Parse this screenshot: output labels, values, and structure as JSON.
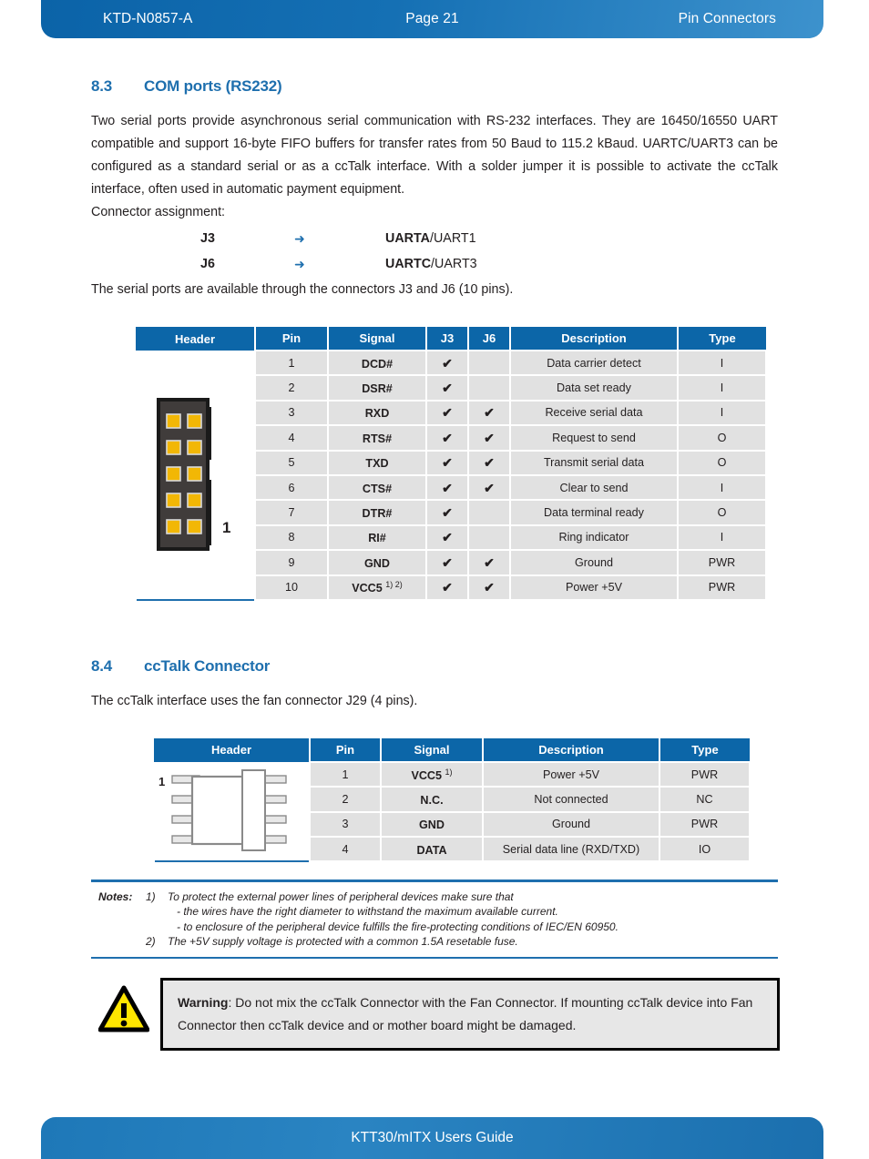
{
  "header": {
    "doc_id": "KTD-N0857-A",
    "page_label": "Page 21",
    "section_label": "Pin Connectors"
  },
  "footer": {
    "title": "KTT30/mITX Users Guide"
  },
  "section_83": {
    "number": "8.3",
    "title": "COM ports (RS232)",
    "paragraph": "Two serial ports provide asynchronous serial communication with RS-232 interfaces. They are 16450/16550 UART compatible and support 16-byte FIFO buffers for transfer rates from 50 Baud to 115.2 kBaud. UARTC/UART3 can be configured as a standard serial or as a ccTalk interface. With a solder jumper it is possible to activate the ccTalk interface, often used in automatic payment equipment.",
    "assignment_intro": "Connector assignment:",
    "assignments": [
      {
        "connector": "J3",
        "arrow": "➜",
        "target_bold": "UARTA",
        "target_rest": "/UART1"
      },
      {
        "connector": "J6",
        "arrow": "➜",
        "target_bold": "UARTC",
        "target_rest": "/UART3"
      }
    ],
    "availability": "The serial ports are available through the connectors J3 and J6 (10 pins).",
    "table": {
      "columns": [
        "Header",
        "Pin",
        "Signal",
        "J3",
        "J6",
        "Description",
        "Type"
      ],
      "connector_pin1_label": "1",
      "rows": [
        {
          "pin": "1",
          "signal": "DCD#",
          "sup": "",
          "j3": "✔",
          "j6": "",
          "desc": "Data carrier detect",
          "type": "I"
        },
        {
          "pin": "2",
          "signal": "DSR#",
          "sup": "",
          "j3": "✔",
          "j6": "",
          "desc": "Data set ready",
          "type": "I"
        },
        {
          "pin": "3",
          "signal": "RXD",
          "sup": "",
          "j3": "✔",
          "j6": "✔",
          "desc": "Receive serial data",
          "type": "I"
        },
        {
          "pin": "4",
          "signal": "RTS#",
          "sup": "",
          "j3": "✔",
          "j6": "✔",
          "desc": "Request to send",
          "type": "O"
        },
        {
          "pin": "5",
          "signal": "TXD",
          "sup": "",
          "j3": "✔",
          "j6": "✔",
          "desc": "Transmit serial data",
          "type": "O"
        },
        {
          "pin": "6",
          "signal": "CTS#",
          "sup": "",
          "j3": "✔",
          "j6": "✔",
          "desc": "Clear to send",
          "type": "I"
        },
        {
          "pin": "7",
          "signal": "DTR#",
          "sup": "",
          "j3": "✔",
          "j6": "",
          "desc": "Data terminal ready",
          "type": "O"
        },
        {
          "pin": "8",
          "signal": "RI#",
          "sup": "",
          "j3": "✔",
          "j6": "",
          "desc": "Ring indicator",
          "type": "I"
        },
        {
          "pin": "9",
          "signal": "GND",
          "sup": "",
          "j3": "✔",
          "j6": "✔",
          "desc": "Ground",
          "type": "PWR"
        },
        {
          "pin": "10",
          "signal": "VCC5",
          "sup": "1) 2)",
          "j3": "✔",
          "j6": "✔",
          "desc": "Power +5V",
          "type": "PWR"
        }
      ]
    }
  },
  "section_84": {
    "number": "8.4",
    "title": "ccTalk Connector",
    "paragraph": "The ccTalk interface uses the fan connector J29 (4 pins).",
    "table": {
      "columns": [
        "Header",
        "Pin",
        "Signal",
        "Description",
        "Type"
      ],
      "connector_pin1_label": "1",
      "rows": [
        {
          "pin": "1",
          "signal": "VCC5",
          "sup": "1)",
          "desc": "Power +5V",
          "type": "PWR"
        },
        {
          "pin": "2",
          "signal": "N.C.",
          "sup": "",
          "desc": "Not connected",
          "type": "NC"
        },
        {
          "pin": "3",
          "signal": "GND",
          "sup": "",
          "desc": "Ground",
          "type": "PWR"
        },
        {
          "pin": "4",
          "signal": "DATA",
          "sup": "",
          "desc": "Serial data line (RXD/TXD)",
          "type": "IO"
        }
      ]
    }
  },
  "notes": {
    "label": "Notes:",
    "items": [
      {
        "num": "1)",
        "text": "To protect the external power lines of peripheral devices make sure that",
        "sub": [
          "- the wires have the right diameter to withstand the maximum available current.",
          "- to enclosure of the peripheral device fulfills the fire-protecting conditions of IEC/EN 60950."
        ]
      },
      {
        "num": "2)",
        "text": "The +5V supply voltage is protected with a common 1.5A resetable fuse.",
        "sub": []
      }
    ]
  },
  "warning": {
    "label": "Warning",
    "text": ": Do not mix the ccTalk Connector with the Fan Connector. If mounting ccTalk device into Fan Connector then ccTalk device and or mother board might be damaged."
  },
  "colors": {
    "brand_blue": "#1e6fae",
    "table_header_blue": "#0c66a8",
    "row_gray": "#e1e1e1",
    "warn_yellow": "#ffe600",
    "connector_body": "#403c3b",
    "connector_pin": "#f2b705"
  }
}
